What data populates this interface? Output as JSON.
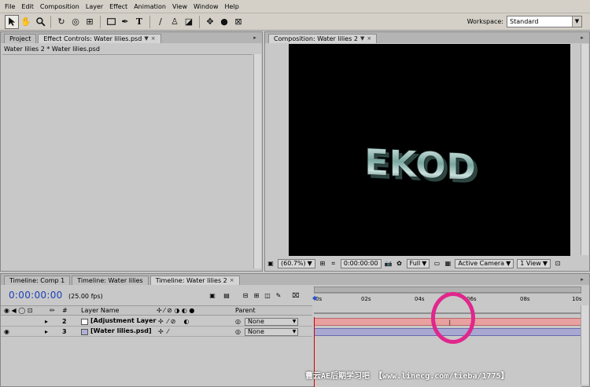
{
  "menu": [
    "File",
    "Edit",
    "Composition",
    "Layer",
    "Effect",
    "Animation",
    "View",
    "Window",
    "Help"
  ],
  "toolbar": {
    "tools": [
      "selection-tool",
      "hand-tool",
      "zoom-tool",
      "rotate-tool",
      "orbit-camera-tool",
      "pan-behind-tool",
      "rectangle-mask-tool",
      "pen-tool",
      "text-tool",
      "brush-tool",
      "clone-stamp-tool",
      "eraser-tool",
      "axis-mode"
    ],
    "workspace_label": "Workspace:",
    "workspace_value": "Standard"
  },
  "left_panel": {
    "tabs": [
      "Project",
      "Effect Controls: Water lilies.psd"
    ],
    "subtitle": "Water lilies 2 * Water lilies.psd"
  },
  "comp_panel": {
    "tab": "Composition: Water lilies 2",
    "text_3d": "EKOD",
    "zoom": "(60.7%)",
    "timecode": "0:00:00:00",
    "resolution": "Full",
    "camera": "Active Camera",
    "view": "1 View"
  },
  "timeline": {
    "tabs": [
      "Timeline: Comp 1",
      "Timeline: Water lilies",
      "Timeline: Water lilies 2"
    ],
    "timecode": "0:00:00:00",
    "fps": "(25.00 fps)",
    "headers": {
      "num": "#",
      "layer_name": "Layer Name",
      "parent": "Parent"
    },
    "layers": [
      {
        "num": "2",
        "name": "[Adjustment Layer",
        "parent": "None",
        "color": "#ffffff",
        "bar_color": "#e8a0a0"
      },
      {
        "num": "3",
        "name": "[Water lilies.psd]",
        "parent": "None",
        "color": "#b0b0d8",
        "bar_color": "#a8a8d0"
      }
    ],
    "ruler_labels": [
      "0s",
      "02s",
      "04s",
      "06s",
      "08s",
      "10s"
    ]
  },
  "watermark": "曹云AE后期学习吧  【www.linecg.com/tieba/1775】",
  "colors": {
    "timecode": "#1c3fb8",
    "highlight_circle": "#e0278c"
  }
}
